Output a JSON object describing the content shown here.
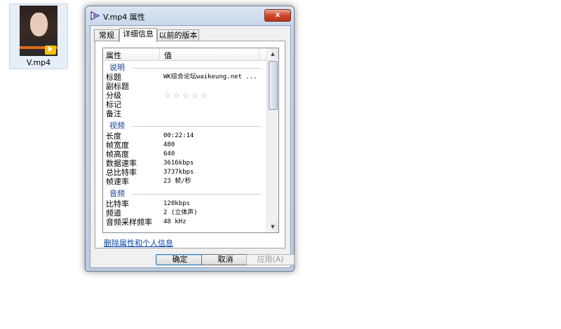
{
  "desktop": {
    "file_name": "V.mp4",
    "badge_color": "#f2c10a"
  },
  "window": {
    "title": "V.mp4 属性",
    "close_symbol": "x",
    "title_icon": "media-file-icon"
  },
  "tabs": [
    {
      "label": "常规",
      "active": false
    },
    {
      "label": "详细信息",
      "active": true
    },
    {
      "label": "以前的版本",
      "active": false
    }
  ],
  "list": {
    "col_property": "属性",
    "col_value": "值",
    "groups": {
      "description": "说明",
      "video": "视频",
      "audio": "音频"
    },
    "description_rows": [
      {
        "k": "标题",
        "v": "WK综合论坛waikeung.net ..."
      },
      {
        "k": "副标题",
        "v": ""
      },
      {
        "k": "分级",
        "v": ""
      },
      {
        "k": "标记",
        "v": ""
      },
      {
        "k": "备注",
        "v": ""
      }
    ],
    "rating": {
      "stars": 5,
      "value": 0
    },
    "video_rows": [
      {
        "k": "长度",
        "v": "00:22:14"
      },
      {
        "k": "帧宽度",
        "v": "480"
      },
      {
        "k": "帧高度",
        "v": "640"
      },
      {
        "k": "数据速率",
        "v": "3616kbps"
      },
      {
        "k": "总比特率",
        "v": "3737kbps"
      },
      {
        "k": "帧速率",
        "v": "23 帧/秒"
      }
    ],
    "audio_rows": [
      {
        "k": "比特率",
        "v": "120kbps"
      },
      {
        "k": "频道",
        "v": "2 (立体声)"
      },
      {
        "k": "音频采样频率",
        "v": "48 kHz"
      }
    ]
  },
  "link_text": "删除属性和个人信息",
  "buttons": {
    "ok": "确定",
    "cancel": "取消",
    "apply": "应用(A)"
  },
  "colors": {
    "link": "#0645ad",
    "group_label": "#1a3e8c",
    "close_button": "#d0462a"
  }
}
